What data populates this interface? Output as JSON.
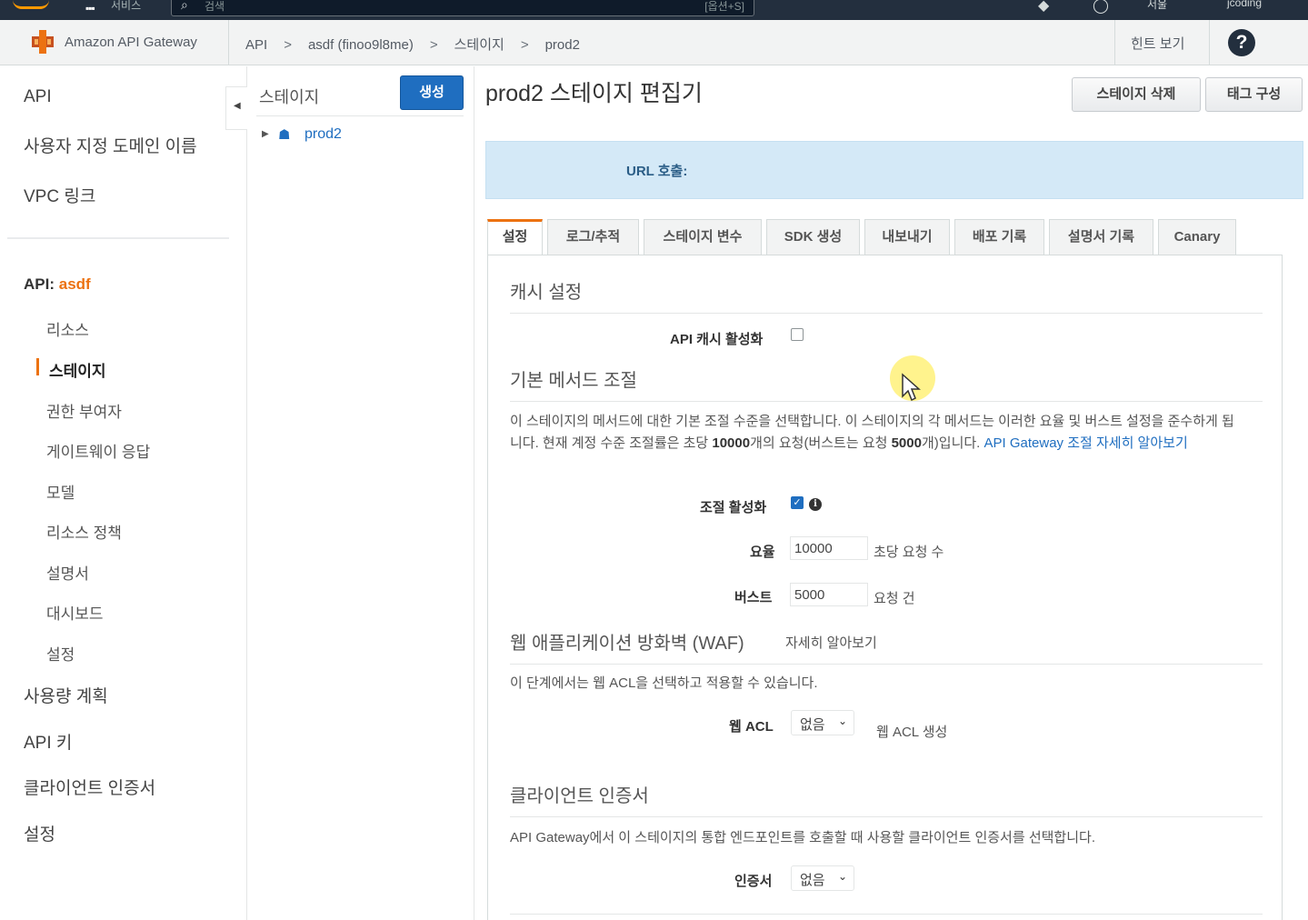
{
  "topbar": {
    "services_label": "서비스",
    "search_placeholder": "검색",
    "search_shortcut": "[옵션+S]",
    "region": "서울",
    "account": "jcoding"
  },
  "servicebar": {
    "service_name": "Amazon API Gateway",
    "breadcrumbs": [
      "API",
      "asdf (finoo9l8me)",
      "스테이지",
      "prod2"
    ],
    "hint_label": "힌트 보기",
    "help_label": "?"
  },
  "leftnav": {
    "top_items": [
      "API",
      "사용자 지정 도메인 이름",
      "VPC 링크"
    ],
    "api_prefix": "API:",
    "api_name": "asdf",
    "sub_items": [
      "리소스",
      "스테이지",
      "권한 부여자",
      "게이트웨이 응답",
      "모델",
      "리소스 정책",
      "설명서",
      "대시보드",
      "설정"
    ],
    "active_item": "스테이지",
    "bottom_items": [
      "사용량 계획",
      "API 키",
      "클라이언트 인증서",
      "설정"
    ]
  },
  "stages": {
    "header": "스테이지",
    "create_label": "생성",
    "tree": [
      {
        "label": "prod2"
      }
    ]
  },
  "main": {
    "title": "prod2 스테이지 편집기",
    "delete_button": "스테이지 삭제",
    "tags_button": "태그 구성",
    "url_label": "URL 호출:",
    "tabs": [
      "설정",
      "로그/추적",
      "스테이지 변수",
      "SDK 생성",
      "내보내기",
      "배포 기록",
      "설명서 기록",
      "Canary"
    ],
    "active_tab": "설정",
    "cache": {
      "title": "캐시 설정",
      "enable_label": "API 캐시 활성화",
      "enabled": false
    },
    "throttle": {
      "title": "기본 메서드 조절",
      "desc_1": "이 스테이지의 메서드에 대한 기본 조절 수준을 선택합니다. 이 스테이지의 각 메서드는 이러한 요율 및 버스트 설정을 준수하게 됩니다. 현재 계정 수준 조절률은 초당 ",
      "desc_rate": "10000",
      "desc_2": "개의 요청(버스트는 요청 ",
      "desc_burst": "5000",
      "desc_3": "개)입니다. ",
      "desc_link": "API Gateway 조절 자세히 알아보기",
      "enable_label": "조절 활성화",
      "enabled": true,
      "info_icon": "i",
      "rate_label": "요율",
      "rate_value": "10000",
      "rate_unit": "초당 요청 수",
      "burst_label": "버스트",
      "burst_value": "5000",
      "burst_unit": "요청 건"
    },
    "waf": {
      "title": "웹 애플리케이션 방화벽 (WAF)",
      "learn_more": "자세히 알아보기",
      "desc": "이 단계에서는 웹 ACL을 선택하고 적용할 수 있습니다.",
      "acl_label": "웹 ACL",
      "acl_value": "없음",
      "create_link": "웹 ACL 생성"
    },
    "client_cert": {
      "title": "클라이언트 인증서",
      "desc": "API Gateway에서 이 스테이지의 통합 엔드포인트를 호출할 때 사용할 클라이언트 인증서를 선택합니다.",
      "cert_label": "인증서",
      "cert_value": "없음"
    }
  },
  "colors": {
    "accent": "#ec7211",
    "primary_button": "#1f6ec0",
    "topbar": "#232f3e",
    "url_box": "#d4e9f7"
  }
}
